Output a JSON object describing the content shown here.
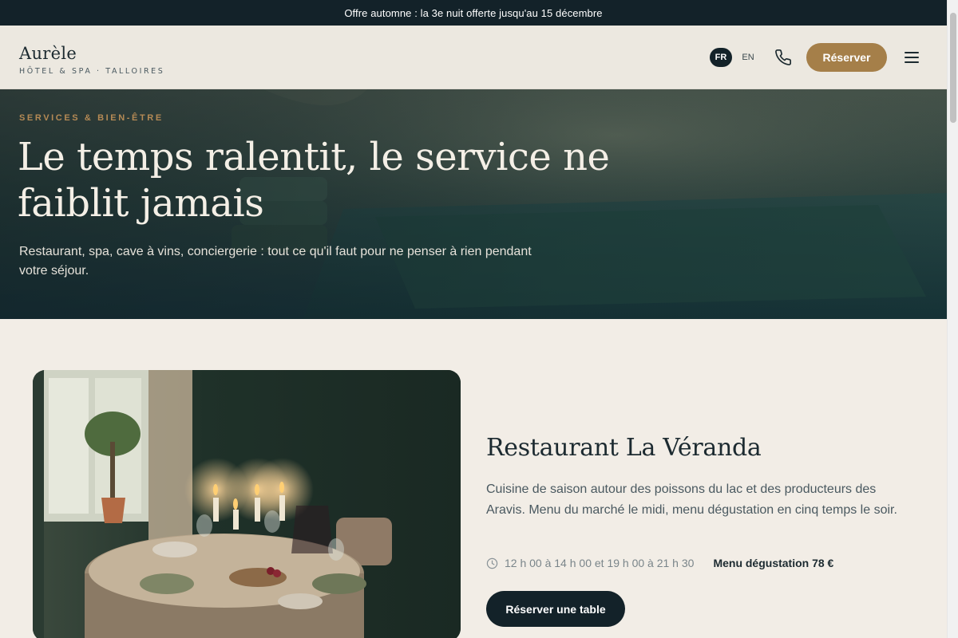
{
  "promo": {
    "text": "Offre automne : la 3e nuit offerte jusqu'au 15 décembre"
  },
  "header": {
    "brand_name": "Aurèle",
    "brand_tagline": "HÔTEL & SPA · TALLOIRES",
    "languages": [
      "FR",
      "EN"
    ],
    "active_language": "FR",
    "book_label": "Réserver",
    "icons": [
      "phone-icon",
      "menu-icon"
    ]
  },
  "hero": {
    "kicker": "SERVICES & BIEN-ÊTRE",
    "title": "Le temps ralentit, le service ne faiblit jamais",
    "subtitle": "Restaurant, spa, cave à vins, conciergerie : tout ce qu'il faut pour ne penser à rien pendant votre séjour."
  },
  "restaurant": {
    "title": "Restaurant La Véranda",
    "description": "Cuisine de saison autour des poissons du lac et des producteurs des Aravis. Menu du marché le midi, menu dégustation en cinq temps le soir.",
    "hours": "12 h 00 à 14 h 00 et 19 h 00 à 21 h 30",
    "price": "Menu dégustation 78 €",
    "cta_label": "Réserver une table"
  },
  "colors": {
    "dark": "#132229",
    "accent": "#a57f49",
    "background": "#f2ede6"
  }
}
